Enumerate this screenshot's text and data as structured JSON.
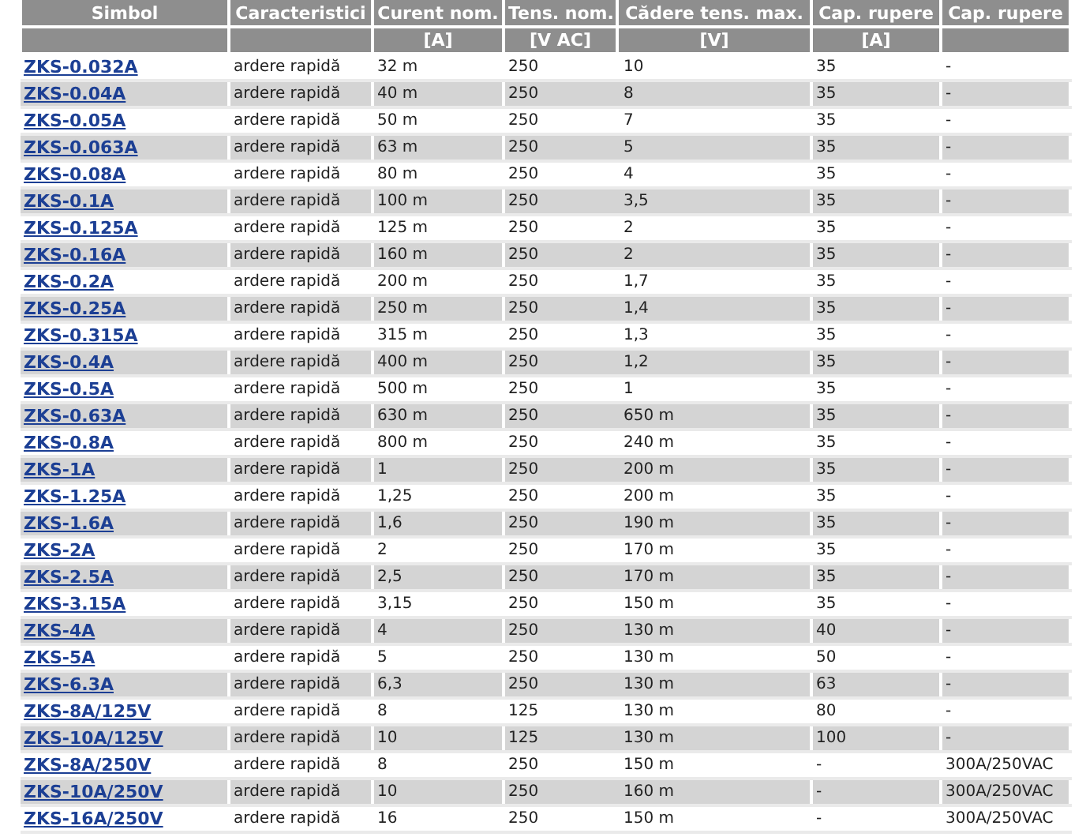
{
  "table": {
    "columns": [
      {
        "label": "Simbol"
      },
      {
        "label": "Caracteristici"
      },
      {
        "label": "Curent nom.",
        "unit": "[A]"
      },
      {
        "label": "Tens. nom.",
        "unit": "[V AC]"
      },
      {
        "label": "Cădere tens. max.",
        "unit": "[V]"
      },
      {
        "label": "Cap. rupere",
        "unit": "[A]"
      },
      {
        "label": "Cap. rupere"
      }
    ],
    "rows": [
      [
        "ZKS-0.032A",
        "ardere rapidă",
        "32 m",
        "250",
        "10",
        "35",
        "-"
      ],
      [
        "ZKS-0.04A",
        "ardere rapidă",
        "40 m",
        "250",
        "8",
        "35",
        "-"
      ],
      [
        "ZKS-0.05A",
        "ardere rapidă",
        "50 m",
        "250",
        "7",
        "35",
        "-"
      ],
      [
        "ZKS-0.063A",
        "ardere rapidă",
        "63 m",
        "250",
        "5",
        "35",
        "-"
      ],
      [
        "ZKS-0.08A",
        "ardere rapidă",
        "80 m",
        "250",
        "4",
        "35",
        "-"
      ],
      [
        "ZKS-0.1A",
        "ardere rapidă",
        "100 m",
        "250",
        "3,5",
        "35",
        "-"
      ],
      [
        "ZKS-0.125A",
        "ardere rapidă",
        "125 m",
        "250",
        "2",
        "35",
        "-"
      ],
      [
        "ZKS-0.16A",
        "ardere rapidă",
        "160 m",
        "250",
        "2",
        "35",
        "-"
      ],
      [
        "ZKS-0.2A",
        "ardere rapidă",
        "200 m",
        "250",
        "1,7",
        "35",
        "-"
      ],
      [
        "ZKS-0.25A",
        "ardere rapidă",
        "250 m",
        "250",
        "1,4",
        "35",
        "-"
      ],
      [
        "ZKS-0.315A",
        "ardere rapidă",
        "315 m",
        "250",
        "1,3",
        "35",
        "-"
      ],
      [
        "ZKS-0.4A",
        "ardere rapidă",
        "400 m",
        "250",
        "1,2",
        "35",
        "-"
      ],
      [
        "ZKS-0.5A",
        "ardere rapidă",
        "500 m",
        "250",
        "1",
        "35",
        "-"
      ],
      [
        "ZKS-0.63A",
        "ardere rapidă",
        "630 m",
        "250",
        "650 m",
        "35",
        "-"
      ],
      [
        "ZKS-0.8A",
        "ardere rapidă",
        "800 m",
        "250",
        "240 m",
        "35",
        "-"
      ],
      [
        "ZKS-1A",
        "ardere rapidă",
        "1",
        "250",
        "200 m",
        "35",
        "-"
      ],
      [
        "ZKS-1.25A",
        "ardere rapidă",
        "1,25",
        "250",
        "200 m",
        "35",
        "-"
      ],
      [
        "ZKS-1.6A",
        "ardere rapidă",
        "1,6",
        "250",
        "190 m",
        "35",
        "-"
      ],
      [
        "ZKS-2A",
        "ardere rapidă",
        "2",
        "250",
        "170 m",
        "35",
        "-"
      ],
      [
        "ZKS-2.5A",
        "ardere rapidă",
        "2,5",
        "250",
        "170 m",
        "35",
        "-"
      ],
      [
        "ZKS-3.15A",
        "ardere rapidă",
        "3,15",
        "250",
        "150 m",
        "35",
        "-"
      ],
      [
        "ZKS-4A",
        "ardere rapidă",
        "4",
        "250",
        "130 m",
        "40",
        "-"
      ],
      [
        "ZKS-5A",
        "ardere rapidă",
        "5",
        "250",
        "130 m",
        "50",
        "-"
      ],
      [
        "ZKS-6.3A",
        "ardere rapidă",
        "6,3",
        "250",
        "130 m",
        "63",
        "-"
      ],
      [
        "ZKS-8A/125V",
        "ardere rapidă",
        "8",
        "125",
        "130 m",
        "80",
        "-"
      ],
      [
        "ZKS-10A/125V",
        "ardere rapidă",
        "10",
        "125",
        "130 m",
        "100",
        "-"
      ],
      [
        "ZKS-8A/250V",
        "ardere rapidă",
        "8",
        "250",
        "150 m",
        "-",
        "300A/250VAC"
      ],
      [
        "ZKS-10A/250V",
        "ardere rapidă",
        "10",
        "250",
        "160 m",
        "-",
        "300A/250VAC"
      ],
      [
        "ZKS-16A/250V",
        "ardere rapidă",
        "16",
        "250",
        "150 m",
        "-",
        "300A/250VAC"
      ]
    ]
  }
}
